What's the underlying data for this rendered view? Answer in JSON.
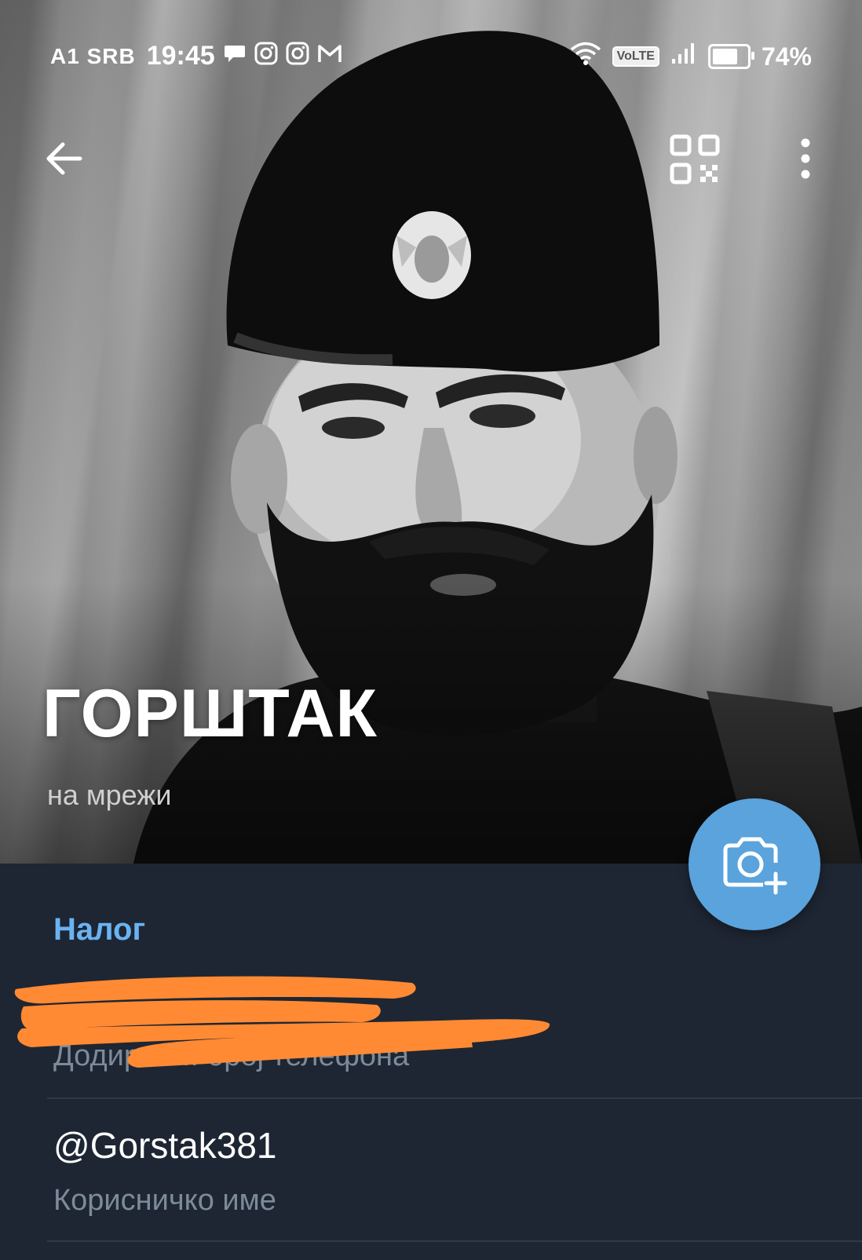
{
  "status_bar": {
    "carrier": "A1 SRB",
    "time": "19:45",
    "network_badge": "VoLTE",
    "battery_text": "74%",
    "battery_level": 0.74,
    "notification_icons": [
      "chat-bubble-icon",
      "instagram-icon",
      "instagram-icon",
      "gmail-icon"
    ],
    "system_icons": [
      "wifi-icon",
      "volte-icon",
      "signal-icon",
      "battery-icon"
    ]
  },
  "toolbar": {
    "back_icon": "arrow-left-icon",
    "qr_icon": "qr-code-icon",
    "more_icon": "more-vertical-icon"
  },
  "profile": {
    "name": "ГОРШТАК",
    "status": "на мрежи",
    "photo_fab_icon": "camera-add-icon"
  },
  "account": {
    "section_title": "Налог",
    "phone": {
      "value": "",
      "label": "Додирни... број телефона",
      "redacted": true
    },
    "username": {
      "value": "@Gorstak381",
      "label": "Корисничко име"
    }
  },
  "colors": {
    "accent": "#6ab3f3",
    "fab": "#5aa3dd",
    "background": "#1e2633",
    "redaction": "#ff8a33"
  }
}
